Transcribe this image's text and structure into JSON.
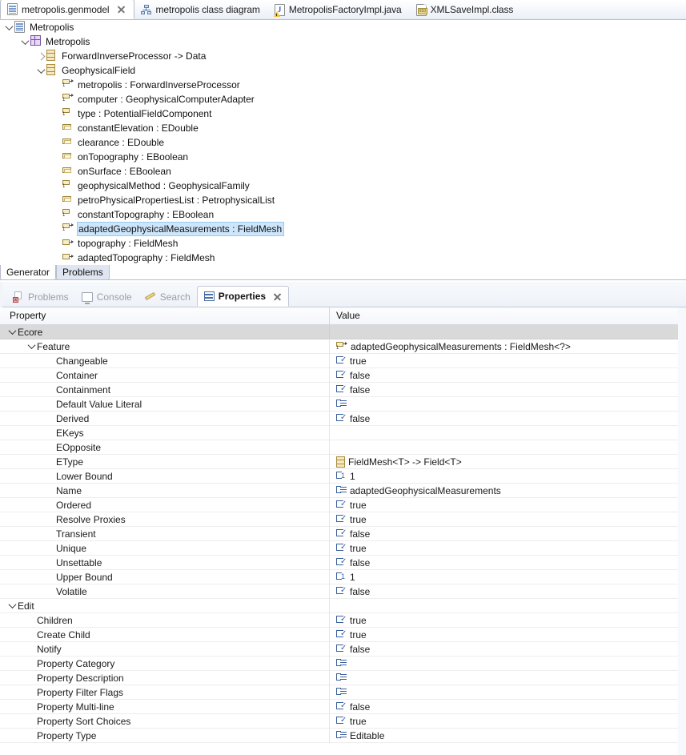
{
  "editor_tabs": [
    {
      "label": "metropolis.genmodel",
      "icon": "genmodel-file-icon",
      "active": true,
      "closable": true
    },
    {
      "label": "metropolis class diagram",
      "icon": "class-diagram-icon",
      "active": false,
      "closable": false
    },
    {
      "label": "MetropolisFactoryImpl.java",
      "icon": "java-file-icon",
      "active": false,
      "closable": false
    },
    {
      "label": "XMLSaveImpl.class",
      "icon": "class-file-icon",
      "active": false,
      "closable": false
    }
  ],
  "tree": {
    "nodes": [
      {
        "label": "Metropolis",
        "indent": 0,
        "twisty": "open",
        "icon": "genmodel-root-icon",
        "selected": false
      },
      {
        "label": "Metropolis",
        "indent": 1,
        "twisty": "open",
        "icon": "epackage-icon",
        "selected": false
      },
      {
        "label": "ForwardInverseProcessor -> Data",
        "indent": 2,
        "twisty": "closed",
        "icon": "eclass-icon",
        "selected": false
      },
      {
        "label": "GeophysicalField",
        "indent": 2,
        "twisty": "open",
        "icon": "eclass-icon",
        "selected": false
      },
      {
        "label": "metropolis : ForwardInverseProcessor",
        "indent": 3,
        "twisty": "none",
        "icon": "ereference-icon",
        "selected": false
      },
      {
        "label": "computer : GeophysicalComputerAdapter",
        "indent": 3,
        "twisty": "none",
        "icon": "ereference-icon",
        "selected": false
      },
      {
        "label": "type : PotentialFieldComponent",
        "indent": 3,
        "twisty": "none",
        "icon": "ereference-single-icon",
        "selected": false
      },
      {
        "label": "constantElevation : EDouble",
        "indent": 3,
        "twisty": "none",
        "icon": "eattribute-icon",
        "selected": false
      },
      {
        "label": "clearance : EDouble",
        "indent": 3,
        "twisty": "none",
        "icon": "eattribute-icon",
        "selected": false
      },
      {
        "label": "onTopography : EBoolean",
        "indent": 3,
        "twisty": "none",
        "icon": "eattribute-icon",
        "selected": false
      },
      {
        "label": "onSurface : EBoolean",
        "indent": 3,
        "twisty": "none",
        "icon": "eattribute-icon",
        "selected": false
      },
      {
        "label": "geophysicalMethod : GeophysicalFamily",
        "indent": 3,
        "twisty": "none",
        "icon": "ereference-single-icon",
        "selected": false
      },
      {
        "label": "petroPhysicalPropertiesList : PetrophysicalList",
        "indent": 3,
        "twisty": "none",
        "icon": "eattribute-icon",
        "selected": false
      },
      {
        "label": "constantTopography : EBoolean",
        "indent": 3,
        "twisty": "none",
        "icon": "ereference-single-icon",
        "selected": false
      },
      {
        "label": "adaptedGeophysicalMeasurements : FieldMesh",
        "indent": 3,
        "twisty": "none",
        "icon": "ereference-icon",
        "selected": true
      },
      {
        "label": "topography : FieldMesh",
        "indent": 3,
        "twisty": "none",
        "icon": "eattribute-arrow-icon",
        "selected": false
      },
      {
        "label": "adaptedTopography : FieldMesh",
        "indent": 3,
        "twisty": "none",
        "icon": "eattribute-arrow-icon",
        "selected": false
      }
    ]
  },
  "generator_tabs": [
    {
      "label": "Generator",
      "active": true
    },
    {
      "label": "Problems",
      "active": false
    }
  ],
  "view_tabs": [
    {
      "label": "Problems",
      "icon": "problems-icon",
      "active": false,
      "closable": false
    },
    {
      "label": "Console",
      "icon": "console-icon",
      "active": false,
      "closable": false
    },
    {
      "label": "Search",
      "icon": "search-icon",
      "active": false,
      "closable": false
    },
    {
      "label": "Properties",
      "icon": "properties-icon",
      "active": true,
      "closable": true
    }
  ],
  "properties": {
    "columns": {
      "property": "Property",
      "value": "Value"
    },
    "rows": [
      {
        "name": "Ecore",
        "level": 0,
        "kind": "group",
        "twisty": "open",
        "value": "",
        "value_icon": "none"
      },
      {
        "name": "Feature",
        "level": 1,
        "kind": "subgroup",
        "twisty": "open",
        "value": "adaptedGeophysicalMeasurements : FieldMesh<?>",
        "value_icon": "ereference-icon"
      },
      {
        "name": "Changeable",
        "level": 2,
        "kind": "item",
        "twisty": "none",
        "value": "true",
        "value_icon": "boolean-icon"
      },
      {
        "name": "Container",
        "level": 2,
        "kind": "item",
        "twisty": "none",
        "value": "false",
        "value_icon": "boolean-icon"
      },
      {
        "name": "Containment",
        "level": 2,
        "kind": "item",
        "twisty": "none",
        "value": "false",
        "value_icon": "boolean-icon"
      },
      {
        "name": "Default Value Literal",
        "level": 2,
        "kind": "item",
        "twisty": "none",
        "value": "",
        "value_icon": "text-icon"
      },
      {
        "name": "Derived",
        "level": 2,
        "kind": "item",
        "twisty": "none",
        "value": "false",
        "value_icon": "boolean-icon"
      },
      {
        "name": "EKeys",
        "level": 2,
        "kind": "item",
        "twisty": "none",
        "value": "",
        "value_icon": "none"
      },
      {
        "name": "EOpposite",
        "level": 2,
        "kind": "item",
        "twisty": "none",
        "value": "",
        "value_icon": "none"
      },
      {
        "name": "EType",
        "level": 2,
        "kind": "item",
        "twisty": "none",
        "value": "FieldMesh<T> -> Field<T>",
        "value_icon": "eclass-icon"
      },
      {
        "name": "Lower Bound",
        "level": 2,
        "kind": "item",
        "twisty": "none",
        "value": "1",
        "value_icon": "number-icon"
      },
      {
        "name": "Name",
        "level": 2,
        "kind": "item",
        "twisty": "none",
        "value": "adaptedGeophysicalMeasurements",
        "value_icon": "text-icon"
      },
      {
        "name": "Ordered",
        "level": 2,
        "kind": "item",
        "twisty": "none",
        "value": "true",
        "value_icon": "boolean-icon"
      },
      {
        "name": "Resolve Proxies",
        "level": 2,
        "kind": "item",
        "twisty": "none",
        "value": "true",
        "value_icon": "boolean-icon"
      },
      {
        "name": "Transient",
        "level": 2,
        "kind": "item",
        "twisty": "none",
        "value": "false",
        "value_icon": "boolean-icon"
      },
      {
        "name": "Unique",
        "level": 2,
        "kind": "item",
        "twisty": "none",
        "value": "true",
        "value_icon": "boolean-icon"
      },
      {
        "name": "Unsettable",
        "level": 2,
        "kind": "item",
        "twisty": "none",
        "value": "false",
        "value_icon": "boolean-icon"
      },
      {
        "name": "Upper Bound",
        "level": 2,
        "kind": "item",
        "twisty": "none",
        "value": "1",
        "value_icon": "number-icon"
      },
      {
        "name": "Volatile",
        "level": 2,
        "kind": "item",
        "twisty": "none",
        "value": "false",
        "value_icon": "boolean-icon"
      },
      {
        "name": "Edit",
        "level": 0,
        "kind": "group2",
        "twisty": "open",
        "value": "",
        "value_icon": "none"
      },
      {
        "name": "Children",
        "level": 1,
        "kind": "item",
        "twisty": "none",
        "value": "true",
        "value_icon": "boolean-icon"
      },
      {
        "name": "Create Child",
        "level": 1,
        "kind": "item",
        "twisty": "none",
        "value": "true",
        "value_icon": "boolean-icon"
      },
      {
        "name": "Notify",
        "level": 1,
        "kind": "item",
        "twisty": "none",
        "value": "false",
        "value_icon": "boolean-icon"
      },
      {
        "name": "Property Category",
        "level": 1,
        "kind": "item",
        "twisty": "none",
        "value": "",
        "value_icon": "text-icon"
      },
      {
        "name": "Property Description",
        "level": 1,
        "kind": "item",
        "twisty": "none",
        "value": "",
        "value_icon": "text-icon"
      },
      {
        "name": "Property Filter Flags",
        "level": 1,
        "kind": "item",
        "twisty": "none",
        "value": "",
        "value_icon": "text-icon"
      },
      {
        "name": "Property Multi-line",
        "level": 1,
        "kind": "item",
        "twisty": "none",
        "value": "false",
        "value_icon": "boolean-icon"
      },
      {
        "name": "Property Sort Choices",
        "level": 1,
        "kind": "item",
        "twisty": "none",
        "value": "true",
        "value_icon": "boolean-icon"
      },
      {
        "name": "Property Type",
        "level": 1,
        "kind": "item",
        "twisty": "none",
        "value": "Editable",
        "value_icon": "text-icon"
      }
    ]
  },
  "colors": {
    "selection": "#cde6fb",
    "group_row": "#d9d9d9",
    "tab_border": "#b6bccc",
    "icon_blue": "#3a5f9e",
    "icon_gold": "#9a8337"
  }
}
